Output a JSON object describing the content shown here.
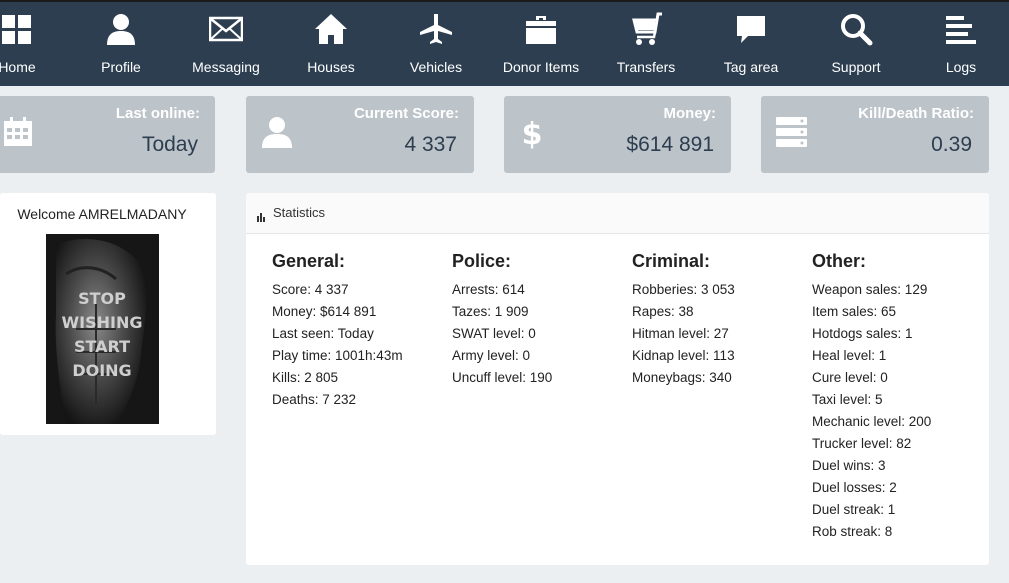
{
  "nav": [
    {
      "label": "Home",
      "icon": "grid-icon"
    },
    {
      "label": "Profile",
      "icon": "user-icon"
    },
    {
      "label": "Messaging",
      "icon": "envelope-icon"
    },
    {
      "label": "Houses",
      "icon": "house-icon"
    },
    {
      "label": "Vehicles",
      "icon": "plane-icon"
    },
    {
      "label": "Donor Items",
      "icon": "briefcase-icon"
    },
    {
      "label": "Transfers",
      "icon": "cart-icon"
    },
    {
      "label": "Tag area",
      "icon": "speech-bubble-icon"
    },
    {
      "label": "Support",
      "icon": "search-icon"
    },
    {
      "label": "Logs",
      "icon": "list-icon"
    }
  ],
  "cards": [
    {
      "title": "Last online:",
      "value": "Today",
      "icon": "calendar-icon"
    },
    {
      "title": "Current Score:",
      "value": "4 337",
      "icon": "user-icon"
    },
    {
      "title": "Money:",
      "value": "$614 891",
      "icon": "dollar-icon"
    },
    {
      "title": "Kill/Death Ratio:",
      "value": "0.39",
      "icon": "server-icon"
    }
  ],
  "welcome": {
    "title": "Welcome AMRELMADANY",
    "poster_text": [
      "STOP",
      "WISHING",
      "START",
      "DOING"
    ]
  },
  "statistics": {
    "title": "Statistics",
    "columns": [
      {
        "heading": "General:",
        "rows": [
          "Score: 4 337",
          "Money: $614 891",
          "Last seen: Today",
          "Play time: 1001h:43m",
          "Kills: 2 805",
          "Deaths: 7 232"
        ]
      },
      {
        "heading": "Police:",
        "rows": [
          "Arrests: 614",
          "Tazes: 1 909",
          "SWAT level: 0",
          "Army level: 0",
          "Uncuff level: 190"
        ]
      },
      {
        "heading": "Criminal:",
        "rows": [
          "Robberies: 3 053",
          "Rapes: 38",
          "Hitman level: 27",
          "Kidnap level: 113",
          "Moneybags: 340"
        ]
      },
      {
        "heading": "Other:",
        "rows": [
          "Weapon sales: 129",
          "Item sales: 65",
          "Hotdogs sales: 1",
          "Heal level: 1",
          "Cure level: 0",
          "Taxi level: 5",
          "Mechanic level: 200",
          "Trucker level: 82",
          "Duel wins: 3",
          "Duel losses: 2",
          "Duel streak: 1",
          "Rob streak: 8"
        ]
      }
    ]
  },
  "colors": {
    "nav_bg": "#2c3e50",
    "card_bg": "#bcc3c9",
    "page_bg": "#eceff1",
    "value_text": "#2c3e50"
  }
}
